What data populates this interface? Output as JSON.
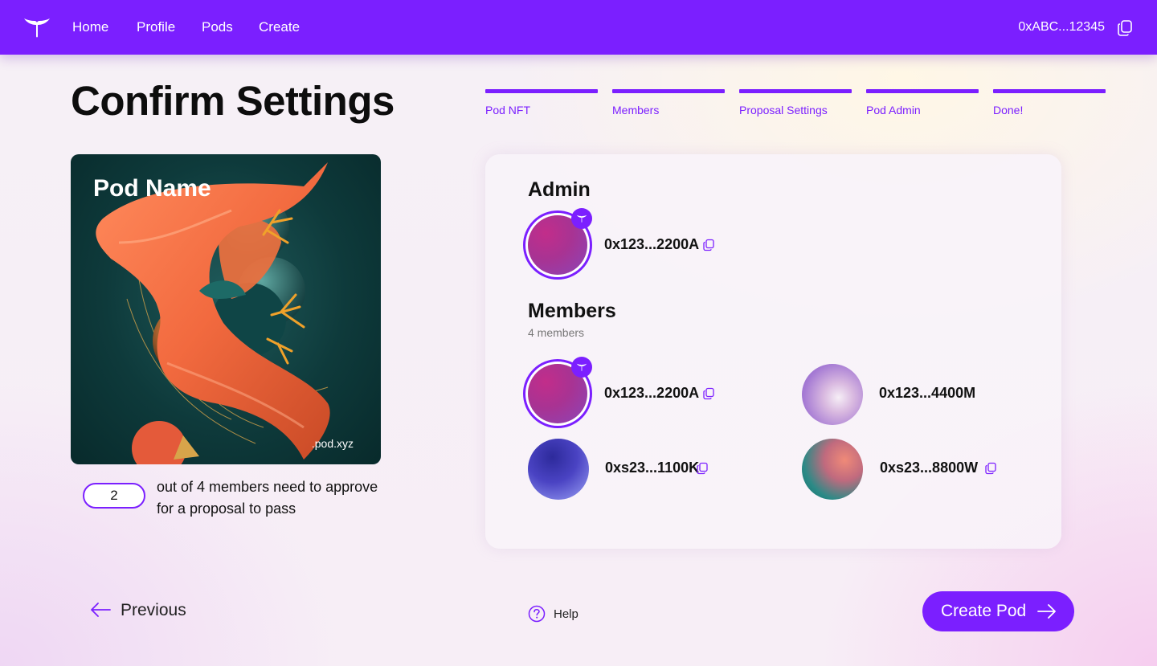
{
  "nav": {
    "links": [
      "Home",
      "Profile",
      "Pods",
      "Create"
    ],
    "wallet": "0xABC...12345"
  },
  "page": {
    "title": "Confirm Settings"
  },
  "stepper": {
    "steps": [
      "Pod NFT",
      "Members",
      "Proposal Settings",
      "Pod Admin",
      "Done!"
    ]
  },
  "nft": {
    "name": "Pod Name",
    "domain": ".pod.xyz"
  },
  "quorum": {
    "value": "2",
    "description": "out of 4 members need to approve for a proposal to pass"
  },
  "admin": {
    "title": "Admin",
    "address": "0x123...2200A"
  },
  "members": {
    "title": "Members",
    "count_label": "4 members",
    "list": [
      {
        "address": "0x123...2200A",
        "is_admin": true
      },
      {
        "address": "0x123...4400M",
        "is_admin": false
      },
      {
        "address": "0xs23...1100K",
        "is_admin": false
      },
      {
        "address": "0xs23...8800W",
        "is_admin": false
      }
    ]
  },
  "footer": {
    "previous_label": "Previous",
    "help_label": "Help",
    "create_label": "Create Pod"
  },
  "colors": {
    "accent": "#7b1fff",
    "text": "#111111"
  },
  "icons": {
    "logo": "whale-tail-logo",
    "copy": "copy-icon",
    "admin_badge": "whale-tail-badge-icon",
    "previous": "arrow-left-icon",
    "next": "arrow-right-icon",
    "help": "question-circle-icon"
  }
}
